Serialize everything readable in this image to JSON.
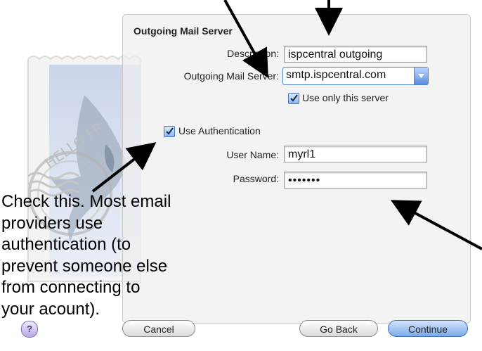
{
  "section_title": "Outgoing Mail Server",
  "fields": {
    "description": {
      "label": "Description:",
      "value": "ispcentral outgoing"
    },
    "outgoing_server": {
      "label": "Outgoing Mail Server:",
      "value": "smtp.ispcentral.com"
    },
    "use_only_server": {
      "label": "Use only this server",
      "checked": true
    },
    "use_authentication": {
      "label": "Use Authentication",
      "checked": true
    },
    "user_name": {
      "label": "User Name:",
      "value": "myrl1"
    },
    "password": {
      "label": "Password:",
      "value": "•••••••"
    }
  },
  "buttons": {
    "help": "?",
    "cancel": "Cancel",
    "go_back": "Go Back",
    "continue": "Continue"
  },
  "annotation": "Check this. Most email\nproviders use\nauthentication (to\nprevent someone else\nfrom connecting to\nyour acount).",
  "colors": {
    "accent": "#4a7fd1",
    "panel": "#eeeeee",
    "arrow": "#000000"
  },
  "icons": {
    "stamp": "mail-stamp-hawk-icon",
    "combo": "dropdown-arrow-icon",
    "check": "checkmark-icon"
  }
}
